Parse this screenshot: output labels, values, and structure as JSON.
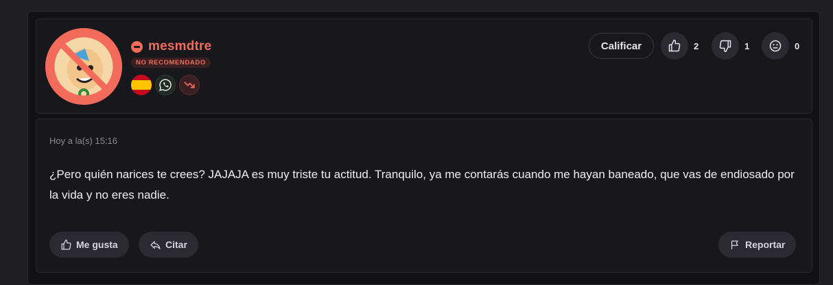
{
  "user": {
    "name": "mesmdtre",
    "status_badge": "NO RECOMENDADO",
    "icons": [
      "spain-flag-icon",
      "whatsapp-icon",
      "trending-down-icon"
    ]
  },
  "actions": {
    "rate_label": "Calificar",
    "likes": "2",
    "dislikes": "1",
    "neutral": "0"
  },
  "post": {
    "timestamp": "Hoy a la(s) 15:16",
    "text": "¿Pero quién narices te crees? JAJAJA es muy triste tu actitud. Tranquilo, ya me contarás cuando me hayan baneado, que vas de endiosado por la vida y no eres nadie."
  },
  "footer": {
    "like_label": "Me gusta",
    "quote_label": "Citar",
    "report_label": "Reportar"
  },
  "colors": {
    "accent": "#f26b5b",
    "background": "#121216",
    "card": "#17171c"
  }
}
